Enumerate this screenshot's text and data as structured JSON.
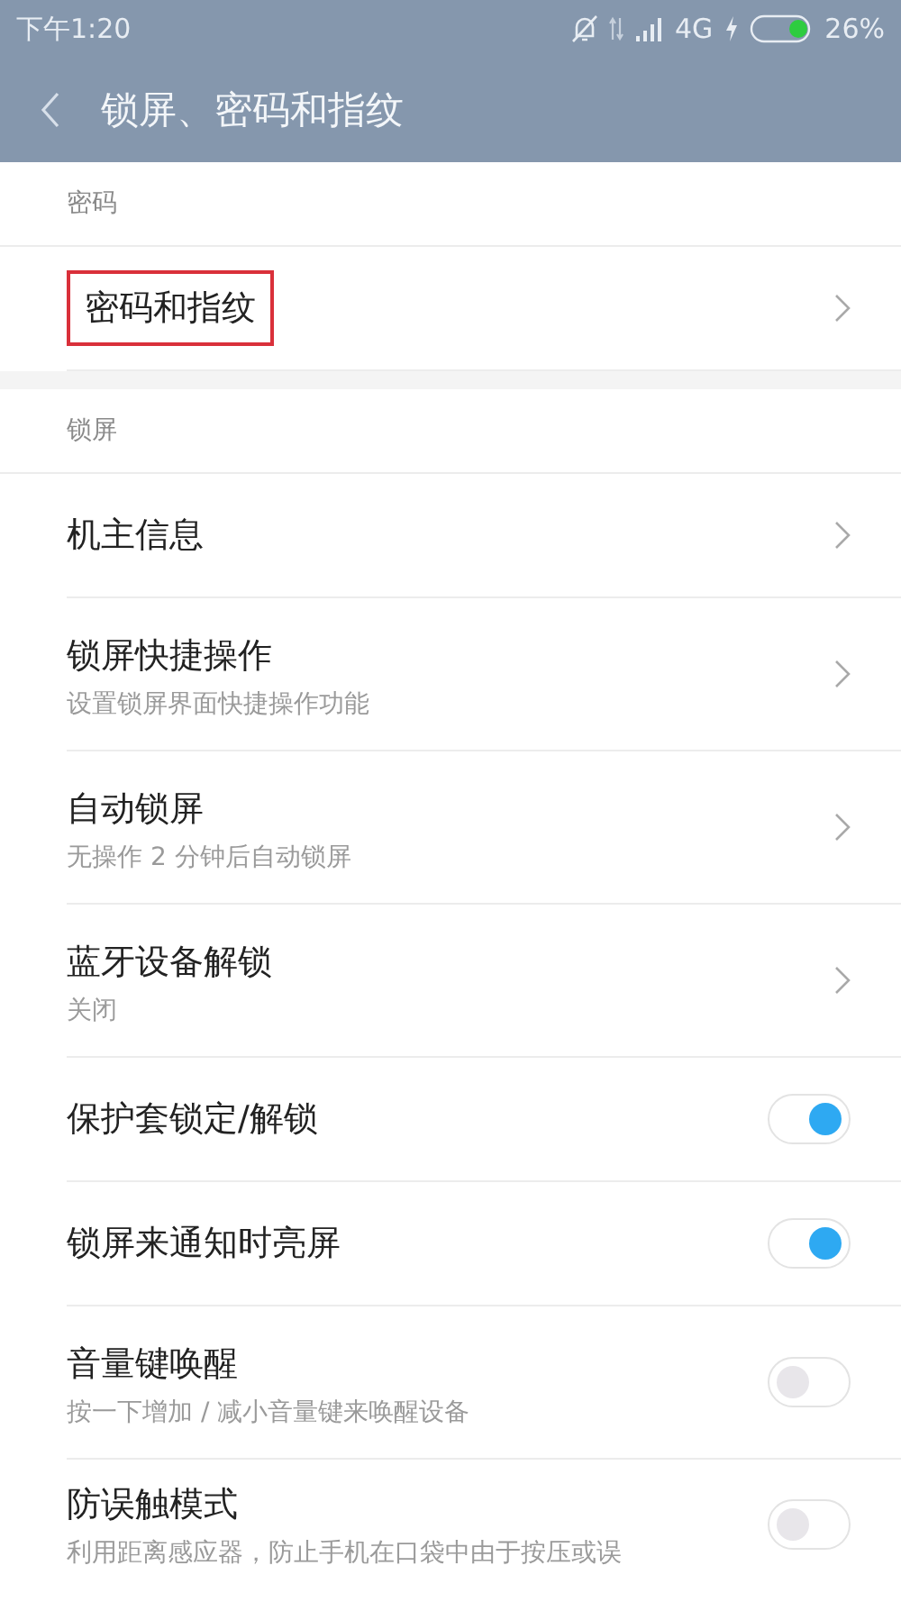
{
  "status_bar": {
    "time": "下午1:20",
    "network": "4G",
    "battery": "26%"
  },
  "header": {
    "title": "锁屏、密码和指纹"
  },
  "sections": [
    {
      "label": "密码",
      "items": [
        {
          "kind": "link",
          "title": "密码和指纹",
          "highlighted": true
        }
      ]
    },
    {
      "label": "锁屏",
      "items": [
        {
          "kind": "link",
          "title": "机主信息",
          "highlighted": false
        },
        {
          "kind": "link",
          "title": "锁屏快捷操作",
          "subtitle": "设置锁屏界面快捷操作功能",
          "highlighted": false
        },
        {
          "kind": "link",
          "title": "自动锁屏",
          "subtitle": "无操作 2 分钟后自动锁屏",
          "highlighted": false
        },
        {
          "kind": "link",
          "title": "蓝牙设备解锁",
          "subtitle": "关闭",
          "highlighted": false
        },
        {
          "kind": "toggle",
          "title": "保护套锁定/解锁",
          "on": true,
          "highlighted": false
        },
        {
          "kind": "toggle",
          "title": "锁屏来通知时亮屏",
          "on": true,
          "highlighted": false
        },
        {
          "kind": "toggle",
          "title": "音量键唤醒",
          "subtitle": "按一下增加 / 减小音量键来唤醒设备",
          "on": false,
          "highlighted": false
        },
        {
          "kind": "toggle",
          "title": "防误触模式",
          "subtitle": "利用距离感应器，防止手机在口袋中由于按压或误",
          "on": false,
          "highlighted": false
        }
      ]
    }
  ]
}
